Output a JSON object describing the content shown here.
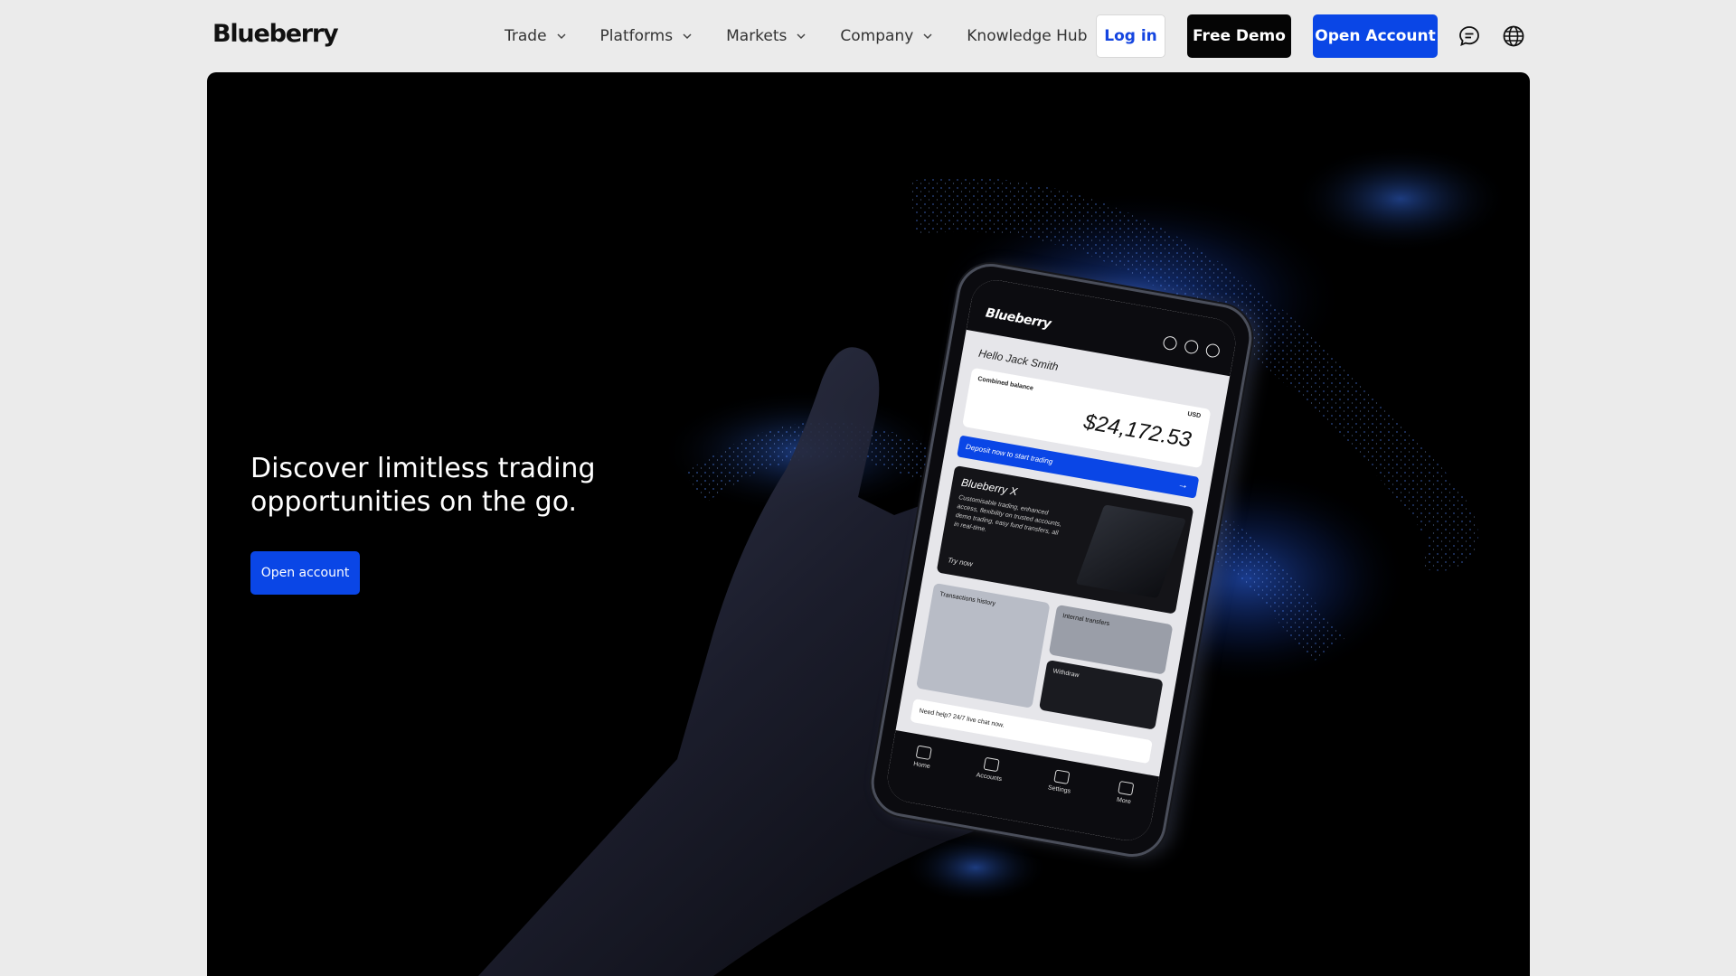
{
  "header": {
    "logo": "Blueberry",
    "nav": [
      {
        "label": "Trade"
      },
      {
        "label": "Platforms"
      },
      {
        "label": "Markets"
      },
      {
        "label": "Company"
      },
      {
        "label": "Knowledge Hub"
      }
    ],
    "login_label": "Log in",
    "demo_label": "Free Demo",
    "open_label": "Open Account",
    "icons": [
      "chat-icon",
      "globe-icon"
    ]
  },
  "hero": {
    "headline": "Discover limitless trading opportunities on the go.",
    "cta_label": "Open account"
  },
  "phone": {
    "brand": "Blueberry",
    "greeting": "Hello Jack Smith",
    "balance_label": "Combined balance",
    "currency": "USD",
    "balance": "$24,172.53",
    "deposit_text": "Deposit now to start trading",
    "card_title": "Blueberry X",
    "card_desc": "Customisable trading, enhanced access, flexibility on trusted accounts, demo trading, easy fund transfers, all in real-time.",
    "card_cta": "Try now",
    "tiles": {
      "transactions": "Transactions history",
      "internal": "Internal transfers",
      "withdraw": "Withdraw"
    },
    "help_text": "Need help? 24/7 live chat now.",
    "tabs": [
      "Home",
      "Accounts",
      "Settings",
      "More"
    ]
  },
  "colors": {
    "brand_blue": "#0a46e6",
    "page_bg": "#ebebeb",
    "hero_bg": "#000000"
  }
}
